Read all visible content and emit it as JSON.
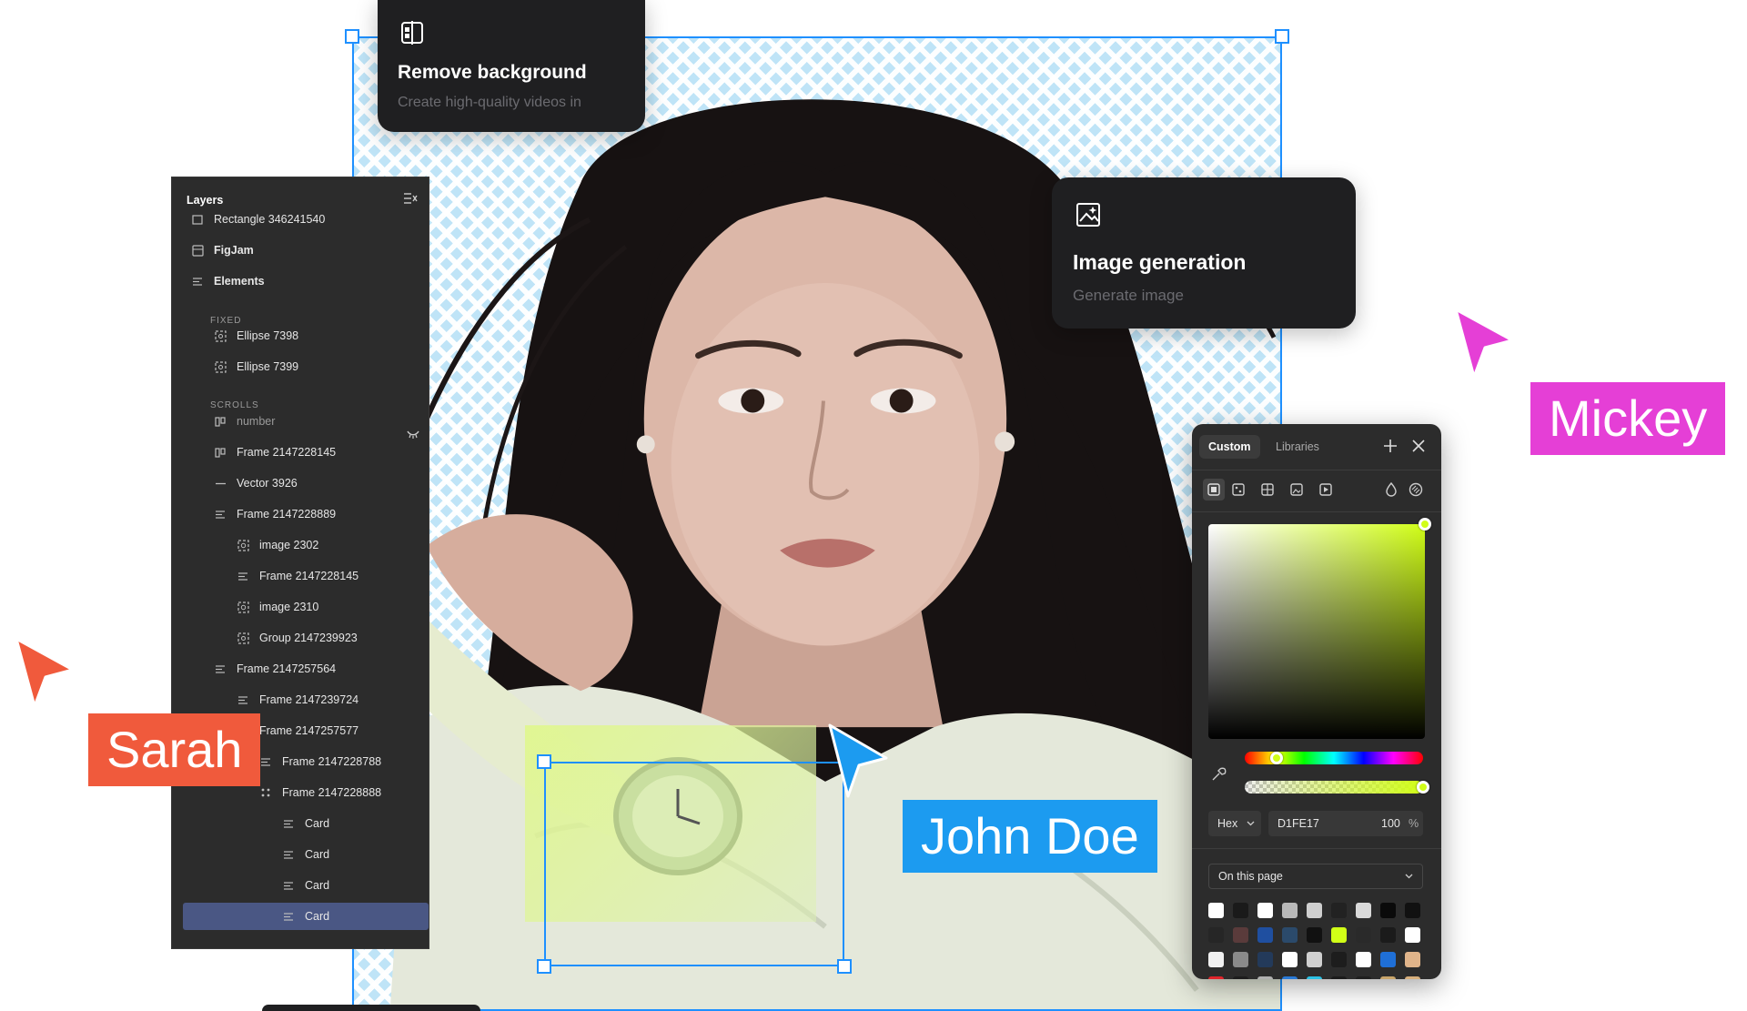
{
  "colors": {
    "selection": "#1e90ff",
    "sarah": "#f05a3c",
    "john": "#1c9bf0",
    "mickey": "#e53fd6",
    "panel_bg": "#2c2c2c",
    "card_bg": "#1f1f21",
    "accent_color": "#D1FE17"
  },
  "cards": {
    "remove_bg": {
      "icon": "split-image-icon",
      "title": "Remove background",
      "subtitle": "Create high-quality videos in"
    },
    "image_gen": {
      "icon": "image-generate-icon",
      "title": "Image generation",
      "subtitle": "Generate image"
    }
  },
  "layers": {
    "title": "Layers",
    "sections": {
      "fixed": "FIXED",
      "scrolls": "SCROLLS"
    },
    "items": [
      {
        "label": "Rectangle 346241540",
        "icon": "rectangle-icon"
      },
      {
        "label": "FigJam",
        "icon": "figjam-icon"
      },
      {
        "label": "Elements",
        "icon": "auto-layout-icon"
      },
      {
        "label": "Ellipse 7398",
        "icon": "frame-dashed-icon"
      },
      {
        "label": "Ellipse 7399",
        "icon": "frame-dashed-icon"
      },
      {
        "label": "number",
        "icon": "columns-icon"
      },
      {
        "label": "Frame 2147228145",
        "icon": "columns-icon"
      },
      {
        "label": "Vector 3926",
        "icon": "line-icon"
      },
      {
        "label": "Frame 2147228889",
        "icon": "auto-layout-icon"
      },
      {
        "label": "image 2302",
        "icon": "image-icon"
      },
      {
        "label": "Frame 2147228145",
        "icon": "auto-layout-icon"
      },
      {
        "label": "image 2310",
        "icon": "image-icon"
      },
      {
        "label": "Group 2147239923",
        "icon": "frame-dashed-icon"
      },
      {
        "label": "Frame 2147257564",
        "icon": "auto-layout-icon"
      },
      {
        "label": "Frame 2147239724",
        "icon": "auto-layout-icon"
      },
      {
        "label": "Frame 2147257577",
        "icon": "auto-layout-icon"
      },
      {
        "label": "Frame 2147228788",
        "icon": "auto-layout-icon"
      },
      {
        "label": "Frame 2147228888",
        "icon": "grid-icon"
      },
      {
        "label": "Card",
        "icon": "auto-layout-icon"
      },
      {
        "label": "Card",
        "icon": "auto-layout-icon"
      },
      {
        "label": "Card",
        "icon": "auto-layout-icon"
      },
      {
        "label": "Card",
        "icon": "auto-layout-icon"
      }
    ]
  },
  "picker": {
    "tabs": [
      "Custom",
      "Libraries"
    ],
    "active_tab": "Custom",
    "format": "Hex",
    "hex": "D1FE17",
    "opacity": "100",
    "opacity_unit": "%",
    "library_select": "On this page",
    "hue": 0.18,
    "alpha": 1.0,
    "swatches": [
      "#ffffff",
      "#1a1a1a",
      "#ffffff",
      "#b9b9b9",
      "#cfcfcf",
      "#222222",
      "#d9d9d9",
      "#0a0a0a",
      "#111111",
      "#262626",
      "#5a3b3b",
      "#1f4fa0",
      "#2b4a6b",
      "#111111",
      "#d1fe17",
      "#2a2a2a",
      "#1b1b1b",
      "#ffffff",
      "#f0f0f0",
      "#8a8a8a",
      "#233a5a",
      "#ffffff",
      "#d0d0d0",
      "#1d1d1d",
      "#ffffff",
      "#1f6fd6",
      "#e0b48a"
    ]
  },
  "users": {
    "sarah": "Sarah",
    "john": "John Doe",
    "mickey": "Mickey"
  }
}
